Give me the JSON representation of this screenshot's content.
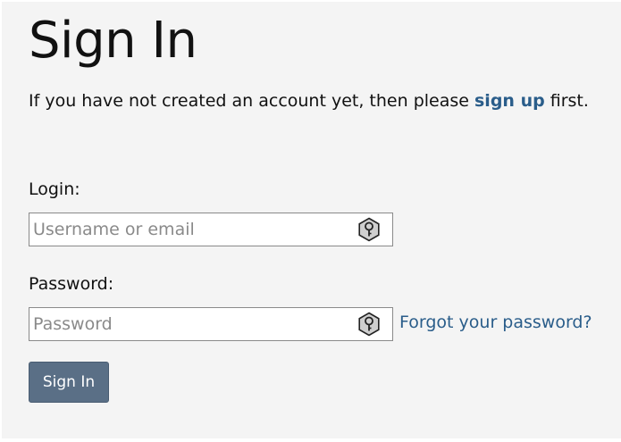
{
  "page": {
    "title": "Sign In",
    "intro_prefix": "If you have not created an account yet, then please ",
    "intro_link": "sign up",
    "intro_suffix": " first."
  },
  "form": {
    "login_label": "Login:",
    "login_placeholder": "Username or email",
    "login_value": "",
    "password_label": "Password:",
    "password_placeholder": "Password",
    "password_value": "",
    "forgot_link": "Forgot your password?",
    "submit_label": "Sign In"
  },
  "icons": {
    "login_field_icon": "key-icon",
    "password_field_icon": "key-icon"
  },
  "colors": {
    "link": "#2a5d8a",
    "button_bg": "#5a6f86",
    "panel_bg": "#f4f4f4"
  }
}
